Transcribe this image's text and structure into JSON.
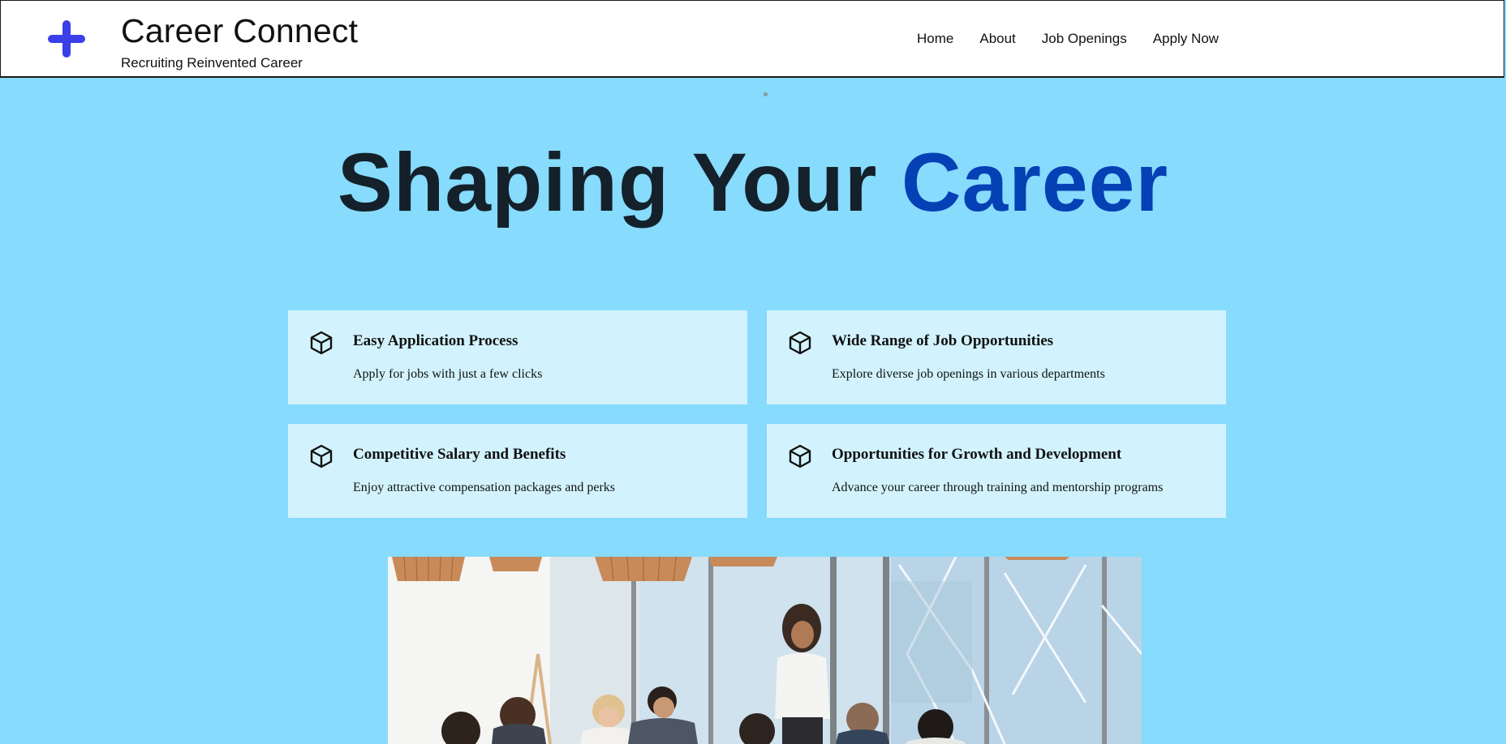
{
  "header": {
    "title": "Career Connect",
    "tagline": "Recruiting Reinvented Career",
    "logo_icon": "plus-icon",
    "logo_color": "#3b3fe8",
    "nav": [
      {
        "label": "Home"
      },
      {
        "label": "About"
      },
      {
        "label": "Job Openings"
      },
      {
        "label": "Apply Now"
      }
    ]
  },
  "hero": {
    "title_main": "Shaping Your",
    "title_accent": "Career",
    "accent_color": "#0540b5",
    "background": "#87dbfc"
  },
  "features": [
    {
      "icon": "cube-icon",
      "title": "Easy Application Process",
      "description": "Apply for jobs with just a few clicks"
    },
    {
      "icon": "cube-icon",
      "title": "Wide Range of Job Opportunities",
      "description": "Explore diverse job openings in various departments"
    },
    {
      "icon": "cube-icon",
      "title": "Competitive Salary and Benefits",
      "description": "Enjoy attractive compensation packages and perks"
    },
    {
      "icon": "cube-icon",
      "title": "Opportunities for Growth and Development",
      "description": "Advance your career through training and mentorship programs"
    }
  ],
  "media": {
    "photo": "office-meeting-photo"
  }
}
